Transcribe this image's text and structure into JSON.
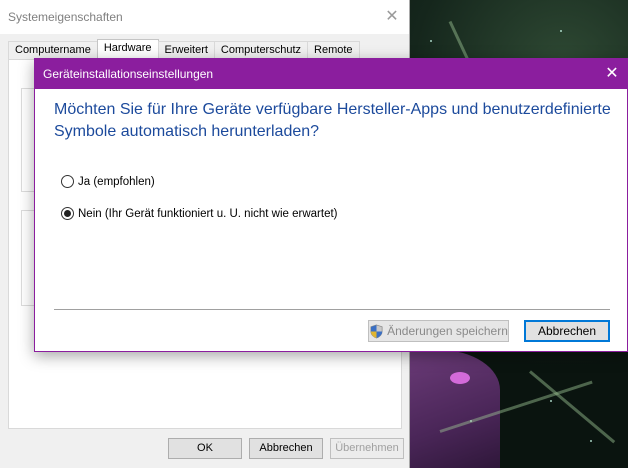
{
  "background_window": {
    "title": "Systemeigenschaften",
    "tabs": [
      "Computername",
      "Hardware",
      "Erweitert",
      "Computerschutz",
      "Remote"
    ],
    "active_tab": "Hardware",
    "buttons": {
      "ok": "OK",
      "cancel": "Abbrechen",
      "apply": "Übernehmen"
    }
  },
  "dialog": {
    "title": "Geräteinstallationseinstellungen",
    "question": "Möchten Sie für Ihre Geräte verfügbare Hersteller-Apps und benutzerdefinierte Symbole automatisch herunterladen?",
    "options": [
      {
        "label": "Ja (empfohlen)",
        "selected": false
      },
      {
        "label": "Nein (Ihr Gerät funktioniert u. U. nicht wie erwartet)",
        "selected": true
      }
    ],
    "buttons": {
      "save": "Änderungen speichern",
      "cancel": "Abbrechen"
    }
  },
  "colors": {
    "dialog_accent": "#8b1e9e",
    "question_text": "#1c4a9c",
    "focus_border": "#0078d7"
  },
  "icons": {
    "close": "close-icon",
    "uac_shield": "uac-shield-icon"
  }
}
